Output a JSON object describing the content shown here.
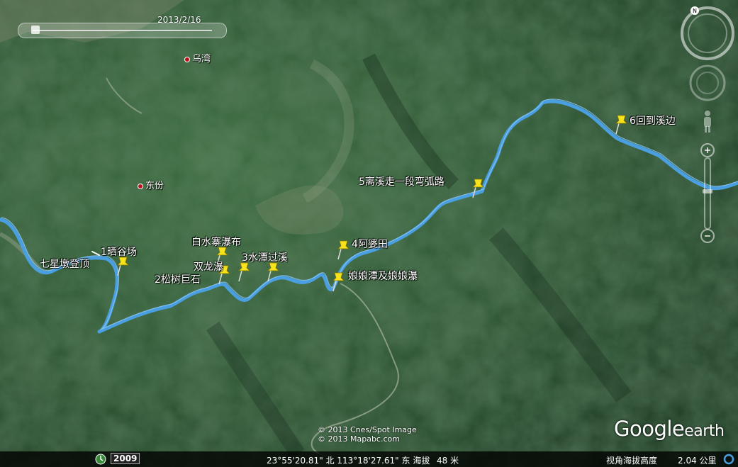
{
  "time_slider": {
    "date": "2013/2/16"
  },
  "places": [
    {
      "name": "乌湾"
    },
    {
      "name": "东份"
    }
  ],
  "placemarks": [
    {
      "label": "七星墩登顶"
    },
    {
      "label": "1晒谷场"
    },
    {
      "label": "2松树巨石"
    },
    {
      "label": "白水寨瀑布"
    },
    {
      "label": "双龙瀑"
    },
    {
      "label": "3水潭过溪"
    },
    {
      "label": "4阿婆田"
    },
    {
      "label": "娘娘潭及娘娘瀑"
    },
    {
      "label": "5离溪走一段弯弧路"
    },
    {
      "label": "6回到溪边"
    }
  ],
  "copyright": {
    "line1": "© 2013 Cnes/Spot Image",
    "line2": "© 2013 Mapabc.com"
  },
  "logo": {
    "google": "Google",
    "earth": "earth"
  },
  "status": {
    "imagery_year": "2009",
    "coords": "23°55'20.81\" 北  113°18'27.61\" 东  海拔",
    "elevation": "48 米",
    "eye_alt_label": "视角海拔高度",
    "eye_alt_value": "2.04 公里"
  },
  "colors": {
    "track": "#4a9fe0",
    "pin": "#f7e21c",
    "terrain": "#2e5530"
  },
  "icons": {
    "north": "north-compass-icon",
    "look": "look-joystick-icon",
    "move": "move-joystick-icon",
    "street": "pegman-icon",
    "zoom": "zoom-slider-icon"
  }
}
